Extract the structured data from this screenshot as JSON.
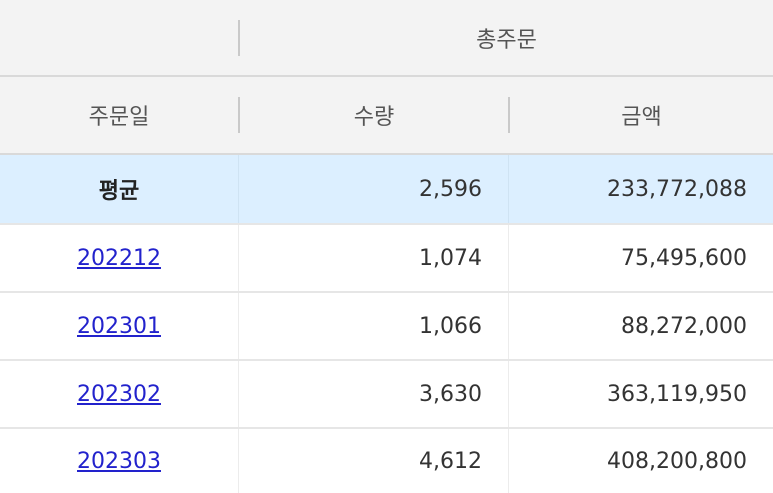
{
  "header": {
    "group_label": "총주문",
    "columns": [
      "주문일",
      "수량",
      "금액"
    ]
  },
  "average_row": {
    "label": "평균",
    "quantity": "2,596",
    "amount": "233,772,088"
  },
  "rows": [
    {
      "date": "202212",
      "quantity": "1,074",
      "amount": "75,495,600"
    },
    {
      "date": "202301",
      "quantity": "1,066",
      "amount": "88,272,000"
    },
    {
      "date": "202302",
      "quantity": "3,630",
      "amount": "363,119,950"
    },
    {
      "date": "202303",
      "quantity": "4,612",
      "amount": "408,200,800"
    }
  ],
  "colors": {
    "header_bg": "#f3f3f3",
    "average_row_bg": "#dcefff",
    "link": "#2222cc"
  }
}
